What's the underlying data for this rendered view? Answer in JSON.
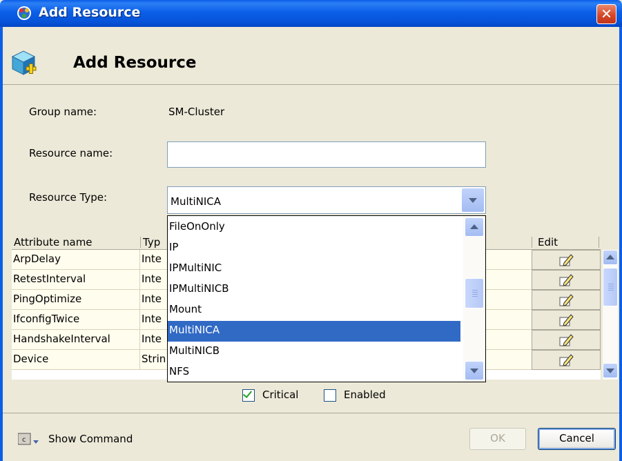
{
  "window": {
    "title": "Add Resource",
    "close_glyph": "✕",
    "icon": "cluster-app-icon"
  },
  "header": {
    "title": "Add Resource",
    "icon": "add-resource-cube-icon"
  },
  "form": {
    "group_name_label": "Group name:",
    "group_name_value": "SM-Cluster",
    "resource_name_label": "Resource name:",
    "resource_name_value": "",
    "resource_type_label": "Resource Type:",
    "resource_type_value": "MultiNICA"
  },
  "dropdown": {
    "options": [
      "FileOnOnly",
      "IP",
      "IPMultiNIC",
      "IPMultiNICB",
      "Mount",
      "MultiNICA",
      "MultiNICB",
      "NFS"
    ],
    "selected": "MultiNICA"
  },
  "table": {
    "headers": {
      "attribute_name": "Attribute name",
      "type": "Typ",
      "edit": "Edit"
    },
    "rows": [
      {
        "name": "ArpDelay",
        "type": "Inte"
      },
      {
        "name": "RetestInterval",
        "type": "Inte"
      },
      {
        "name": "PingOptimize",
        "type": "Inte"
      },
      {
        "name": "IfconfigTwice",
        "type": "Inte"
      },
      {
        "name": "HandshakeInterval",
        "type": "Inte"
      },
      {
        "name": "Device",
        "type": "Strin"
      }
    ]
  },
  "options": {
    "critical_label": "Critical",
    "critical_checked": true,
    "enabled_label": "Enabled",
    "enabled_checked": false
  },
  "footer": {
    "show_command_label": "Show Command",
    "ok_label": "OK",
    "cancel_label": "Cancel"
  },
  "colors": {
    "titlebar": "#0b5fe8",
    "selection": "#316ac5",
    "row_bg": "#fffded",
    "dialog_bg": "#ece9d8"
  }
}
